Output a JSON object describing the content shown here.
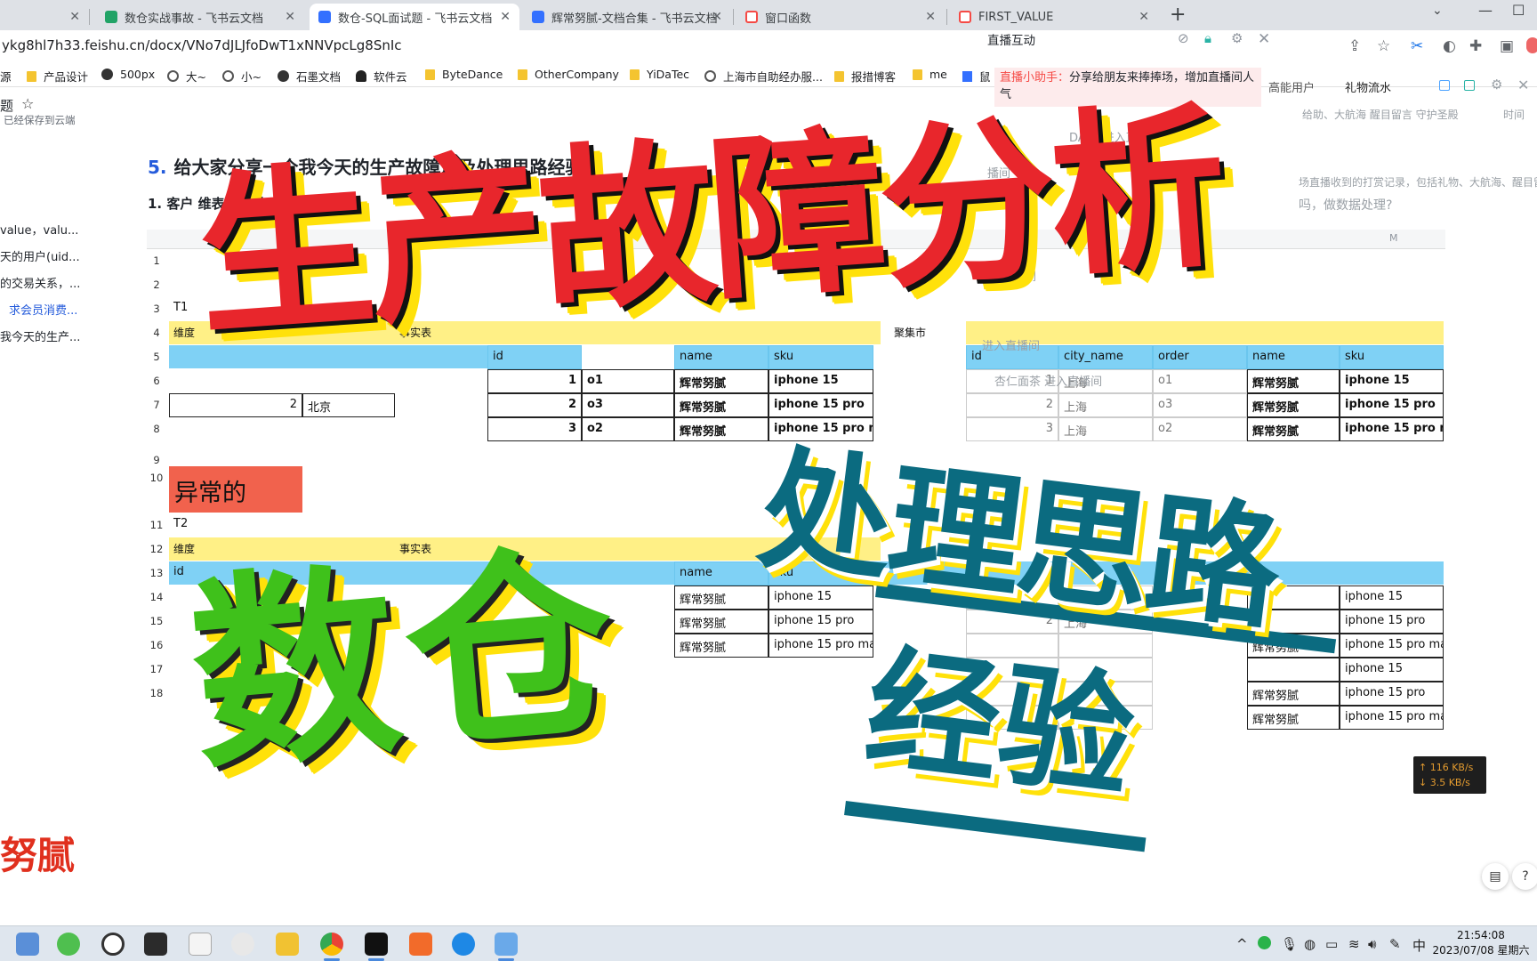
{
  "browser": {
    "tabs": [
      {
        "label": "",
        "color": "#999"
      },
      {
        "label": "数仓实战事故 - 飞书云文档",
        "color": "#21a366"
      },
      {
        "label": "数仓-SQL面试题 - 飞书云文档",
        "color": "#3370ff",
        "active": true
      },
      {
        "label": "辉常努腻-文档合集 - 飞书云文档",
        "color": "#3370ff"
      },
      {
        "label": "窗口函数",
        "color": "#f54a45"
      },
      {
        "label": "FIRST_VALUE",
        "color": "#f54a45"
      }
    ],
    "new_tab": "+",
    "url": "ykg8hl7h33.feishu.cn/docx/VNo7dJLJfoDwT1xNNVpcLg8SnIc",
    "bookmarks": [
      "源",
      "产品设计",
      "500px",
      "大~",
      "小~",
      "石墨文档",
      "软件云",
      "ByteDance",
      "OtherCompany",
      "YiDaTec",
      "上海市自助经办服...",
      "报措博客",
      "me",
      "鼠"
    ]
  },
  "doc": {
    "title": "题",
    "saved_status": "已经保存到云端",
    "outline": [
      "value，valu...",
      "天的用户(uid...",
      "的交易关系，...",
      "求会员消费...",
      "我今天的生产..."
    ],
    "heading_num": "5.",
    "heading": "给大家分享一个我今天的生产故障以及处理思路经验",
    "subheading_num": "1.",
    "subheading": "客户    维表从80条",
    "author_tag": "努腻"
  },
  "sheet": {
    "col_letters": [
      "D",
      "M"
    ],
    "row_numbers": [
      "1",
      "2",
      "3",
      "4",
      "5",
      "6",
      "7",
      "8",
      "9",
      "10",
      "11",
      "12",
      "13",
      "14",
      "15",
      "16",
      "17",
      "18"
    ],
    "t1_label": "T1",
    "t2_label": "T2",
    "dim_label": "维度",
    "fact_label": "事实表",
    "fact_label2": "聚集市",
    "abnormal_label": "异常的",
    "beijing_id": "2",
    "beijing": "北京",
    "left_headers": [
      "id",
      "",
      "name",
      "sku"
    ],
    "left_rows": [
      {
        "id": "1",
        "order": "o1",
        "name": "辉常努腻",
        "sku": "iphone 15"
      },
      {
        "id": "2",
        "order": "o3",
        "name": "辉常努腻",
        "sku": "iphone 15 pro"
      },
      {
        "id": "3",
        "order": "o2",
        "name": "辉常努腻",
        "sku": "iphone 15 pro max"
      }
    ],
    "right_headers": [
      "id",
      "city_name",
      "order",
      "name",
      "sku"
    ],
    "right_rows": [
      {
        "id": "1",
        "city": "上海",
        "order": "o1",
        "name": "辉常努腻",
        "sku": "iphone 15"
      },
      {
        "id": "2",
        "city": "上海",
        "order": "o3",
        "name": "辉常努腻",
        "sku": "iphone 15 pro"
      },
      {
        "id": "3",
        "city": "上海",
        "order": "o2",
        "name": "辉常努腻",
        "sku": "iphone 15 pro max"
      }
    ],
    "lower_left_headers": [
      "name",
      "sku"
    ],
    "lower_left_rows": [
      {
        "name": "辉常努腻",
        "sku": "iphone 15"
      },
      {
        "name": "辉常努腻",
        "sku": "iphone 15 pro"
      },
      {
        "name": "辉常努腻",
        "sku": "iphone 15 pro max"
      }
    ],
    "lower_right_rows": [
      {
        "id": "",
        "city": "",
        "name": "",
        "sku": "iphone 15"
      },
      {
        "id": "2",
        "city": "上海",
        "name": "",
        "sku": "iphone 15 pro"
      },
      {
        "id": "",
        "city": "",
        "name": "辉常努腻",
        "sku": "iphone 15 pro max"
      },
      {
        "id": "",
        "city": "",
        "name": "",
        "sku": "iphone 15"
      },
      {
        "id": "",
        "city": "",
        "name": "辉常努腻",
        "sku": "iphone 15 pro"
      },
      {
        "id": "",
        "city": "",
        "name": "辉常努腻",
        "sku": "iphone 15 pro max"
      }
    ]
  },
  "live": {
    "title": "直播互动",
    "assistant_label": "直播小助手：",
    "assistant_msg": "分享给朋友来捧捧场，增加直播间人气",
    "high_user": "高能用户",
    "gift_flow": "礼物流水",
    "tabs_row": "给助、大航海   醒目留言 守护圣殿",
    "time_label": "时间",
    "faded_lines": [
      "DATA 进入直",
      "进入直播间",
      "播间",
      "进入直播间",
      "进入直播间",
      "杏仁面茶 进入直播间",
      "场直播收到的打赏记录，包括礼物、大航海、醒目留言",
      "吗，做数据处理?"
    ]
  },
  "overlay": {
    "line1": "生产故障分析",
    "line2": "数仓",
    "line3": "处理思路",
    "line4": "经验"
  },
  "net": {
    "up": "↑ 116 KB/s",
    "down": "↓ 3.5 KB/s"
  },
  "taskbar": {
    "ime": "中",
    "time": "21:54:08",
    "date": "2023/07/08 星期六"
  }
}
